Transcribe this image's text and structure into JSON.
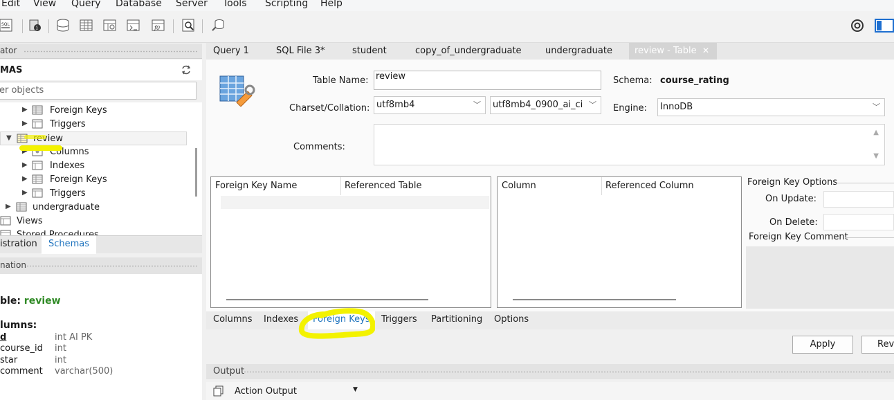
{
  "menu": [
    "Edit",
    "View",
    "Query",
    "Database",
    "Server",
    "Tools",
    "Scripting",
    "Help"
  ],
  "toolbar_icons": [
    "new-sql-tab-icon",
    "open-sql-file-icon",
    "inspector-icon",
    "create-schema-icon",
    "create-table-icon",
    "create-view-icon",
    "create-procedure-icon",
    "create-function-icon",
    "search-table-data-icon",
    "reconnect-icon",
    "preferences-icon",
    "toggle-sidebar-icon"
  ],
  "sidebar": {
    "header": "ator",
    "schemas_label": "MAS",
    "filter_placeholder": "er objects",
    "tree": [
      {
        "label": "Foreign Keys",
        "icon": "foreign-keys-icon"
      },
      {
        "label": "Triggers",
        "icon": "triggers-icon"
      },
      {
        "label": "review",
        "icon": "table-icon",
        "selected": true
      },
      {
        "label": "Columns",
        "icon": "columns-icon"
      },
      {
        "label": "Indexes",
        "icon": "indexes-icon"
      },
      {
        "label": "Foreign Keys",
        "icon": "foreign-keys-icon"
      },
      {
        "label": "Triggers",
        "icon": "triggers-icon"
      },
      {
        "label": "undergraduate",
        "icon": "table-icon"
      },
      {
        "label": "Views",
        "icon": "views-icon"
      },
      {
        "label": "Stored Procedures",
        "icon": "procedures-icon"
      }
    ],
    "tabs": {
      "administration": "istration",
      "schemas": "Schemas"
    },
    "info_header": "nation",
    "info": {
      "table_prefix": "ble: ",
      "table_name": "review",
      "columns_heading": "lumns:",
      "columns": [
        {
          "name": "d",
          "type": "int AI PK"
        },
        {
          "name": "course_id",
          "type": "int"
        },
        {
          "name": "star",
          "type": "int"
        },
        {
          "name": "comment",
          "type": "varchar(500)"
        }
      ]
    }
  },
  "editor_tabs": [
    "Query 1",
    "SQL File 3*",
    "student",
    "copy_of_undergraduate",
    "undergraduate",
    "review - Table"
  ],
  "active_tab": "review - Table",
  "form": {
    "table_name_label": "Table Name:",
    "table_name": "review",
    "schema_label": "Schema:",
    "schema": "course_rating",
    "charset_label": "Charset/Collation:",
    "charset": "utf8mb4",
    "collation": "utf8mb4_0900_ai_ci",
    "engine_label": "Engine:",
    "engine": "InnoDB",
    "comments_label": "Comments:",
    "comments": ""
  },
  "fk_grid": {
    "col1": "Foreign Key Name",
    "col2": "Referenced Table"
  },
  "col_grid": {
    "col1": "Column",
    "col2": "Referenced Column"
  },
  "fk_options": {
    "title": "Foreign Key Options",
    "on_update": "On Update:",
    "on_delete": "On Delete:",
    "comment_title": "Foreign Key Comment"
  },
  "subtabs": [
    "Columns",
    "Indexes",
    "Foreign Keys",
    "Triggers",
    "Partitioning",
    "Options"
  ],
  "active_subtab": "Foreign Keys",
  "buttons": {
    "apply": "Apply",
    "revert": "Rev"
  },
  "output": {
    "header": "Output",
    "selector": "Action Output"
  },
  "colors": {
    "accent_link": "#1e73be",
    "highlight": "#f3f200",
    "table_name_green": "#2f8a25"
  }
}
